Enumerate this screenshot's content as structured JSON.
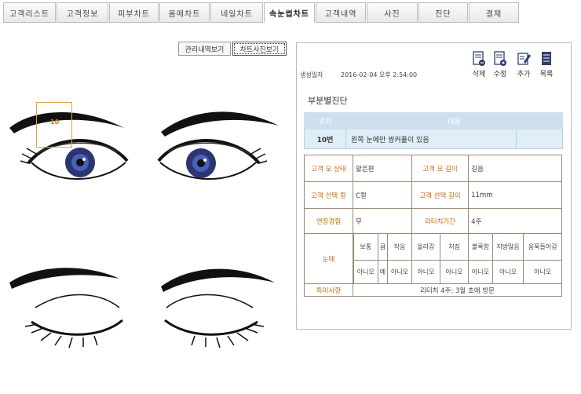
{
  "tabs": [
    "고객리스트",
    "고객정보",
    "피부차트",
    "몸매차트",
    "네일차트",
    "속눈썹차트",
    "고객내역",
    "사진",
    "진단",
    "결제"
  ],
  "view_buttons": {
    "history": "관리내역보기",
    "chart_photo": "차트사진보기"
  },
  "marker_label": "10",
  "panel": {
    "date_label": "생성일자",
    "date_value": "2016-02-04 오후 2:54:00",
    "actions": [
      {
        "label": "삭제",
        "icon": "delete-icon"
      },
      {
        "label": "수정",
        "icon": "edit-icon"
      },
      {
        "label": "추가",
        "icon": "add-icon"
      },
      {
        "label": "목록",
        "icon": "list-icon"
      }
    ],
    "section_title": "부분별진단",
    "part_table": {
      "headers": [
        "위치",
        "내용"
      ],
      "rows": [
        [
          "10번",
          "왼쪽 눈에만 쌍커풀이 있음"
        ]
      ]
    },
    "chart": {
      "hair_state_label": "고객 모 상태",
      "hair_state_value": "얇은편",
      "hair_length_label": "고객 모 길이",
      "hair_length_value": "길음",
      "curl_label": "고객 선택 컬",
      "curl_value": "C컬",
      "sel_length_label": "고객 선택 길이",
      "sel_length_value": "11mm",
      "ext_exp_label": "연장경험",
      "ext_exp_value": "무",
      "retouch_label": "리터치기간",
      "retouch_value": "4주",
      "eye_label": "눈매",
      "eye_headers": [
        "보통",
        "큼",
        "작음",
        "올라감",
        "처짐",
        "볼록함",
        "지방많음",
        "움푹들어감"
      ],
      "eye_values": [
        "아니오",
        "예",
        "아니오",
        "아니오",
        "아니오",
        "아니오",
        "아니오",
        "아니오"
      ],
      "notes_label": "특이사항",
      "notes_value": "리터치 4주: 3월 초에 방문"
    }
  }
}
